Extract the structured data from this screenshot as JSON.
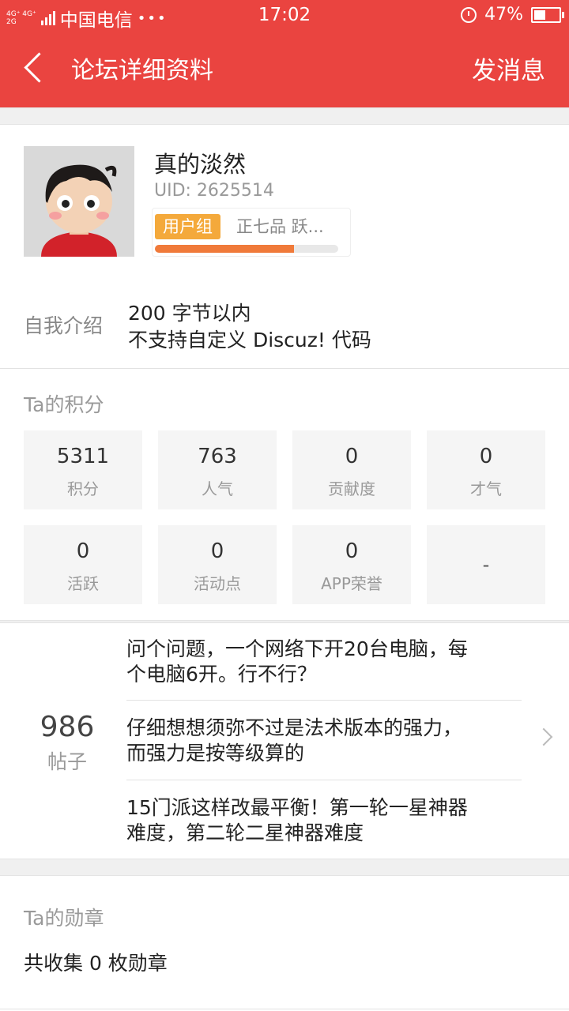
{
  "status_bar": {
    "net_top": "4G⁺ 4G⁺",
    "net_bottom": "2G",
    "carrier": "中国电信",
    "dots": "•••",
    "time": "17:02",
    "battery": "47%"
  },
  "header": {
    "title": "论坛详细资料",
    "action": "发消息"
  },
  "profile": {
    "username": "真的淡然",
    "uid": "UID: 2625514",
    "group_tag": "用户组",
    "group_rank": "正七品  跃...",
    "progress_fraction": 0.76
  },
  "intro": {
    "label": "自我介绍",
    "line1": "200 字节以内",
    "line2": "不支持自定义 Discuz! 代码"
  },
  "scores": {
    "title": "Ta的积分",
    "cells": [
      {
        "value": "5311",
        "label": "积分"
      },
      {
        "value": "763",
        "label": "人气"
      },
      {
        "value": "0",
        "label": "贡献度"
      },
      {
        "value": "0",
        "label": "才气"
      },
      {
        "value": "0",
        "label": "活跃"
      },
      {
        "value": "0",
        "label": "活动点"
      },
      {
        "value": "0",
        "label": "APP荣誉"
      },
      {
        "value": "-",
        "label": ""
      }
    ]
  },
  "posts": {
    "count": "986",
    "label": "帖子",
    "items": [
      {
        "line1": "问个问题，一个网络下开20台电脑，每",
        "line2": "个电脑6开。行不行？"
      },
      {
        "line1": "仔细想想须弥不过是法术版本的强力，",
        "line2": "而强力是按等级算的"
      },
      {
        "line1": "15门派这样改最平衡！第一轮一星神器",
        "line2": "难度，第二轮二星神器难度"
      }
    ]
  },
  "medals": {
    "title": "Ta的勋章",
    "text": "共收集 0 枚勋章"
  },
  "colors": {
    "brand_red": "#ea4440",
    "group_tag": "#f4a93b",
    "progress": "#f07a3a"
  }
}
